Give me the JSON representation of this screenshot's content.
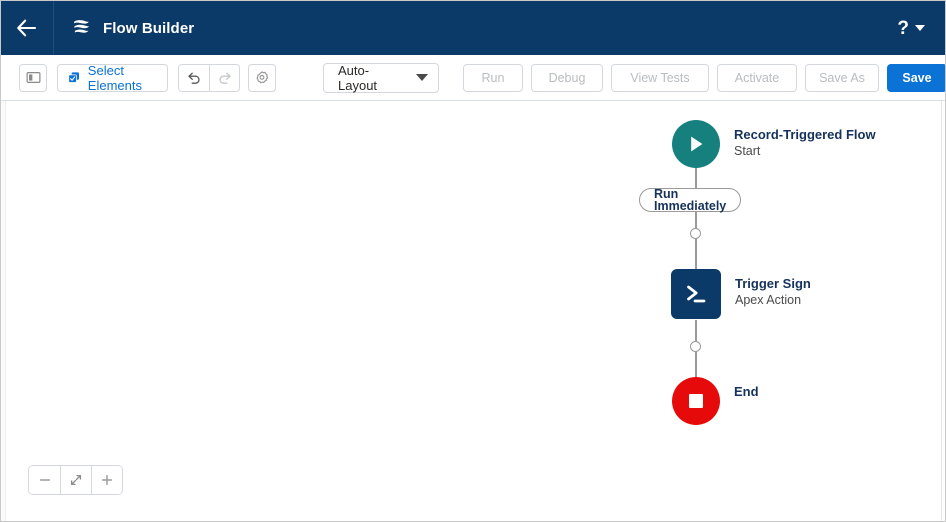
{
  "header": {
    "back_icon": "arrow-left-icon",
    "logo_icon": "flow-builder-logo-icon",
    "title": "Flow Builder",
    "help_label": "?",
    "help_icon": "help-question-icon",
    "caret_icon": "chevron-down-icon",
    "background": "#0b3a69"
  },
  "toolbar": {
    "toggle_panel_icon": "left-panel-toggle-icon",
    "select_elements": {
      "icon": "multi-select-checkbox-icon",
      "label": "Select Elements"
    },
    "undo_icon": "undo-arrow-icon",
    "redo_icon": "redo-arrow-icon",
    "settings_icon": "gear-icon",
    "layout_mode": {
      "value": "Auto-Layout",
      "caret_icon": "chevron-down-icon"
    },
    "run_label": "Run",
    "debug_label": "Debug",
    "view_tests_label": "View Tests",
    "activate_label": "Activate",
    "save_as_label": "Save As",
    "save_label": "Save",
    "primary_color": "#0b72d6"
  },
  "canvas": {
    "flow": {
      "start": {
        "icon": "play-triangle-icon",
        "title": "Record-Triggered Flow",
        "subtitle": "Start",
        "color": "#16807e"
      },
      "schedule_pill": {
        "label": "Run Immediately"
      },
      "add_element_top_icon": "add-element-circle-icon",
      "apex": {
        "icon": "apex-terminal-icon",
        "title": "Trigger Sign",
        "subtitle": "Apex Action",
        "color": "#0b3a69"
      },
      "add_element_bottom_icon": "add-element-circle-icon",
      "end": {
        "icon": "stop-square-icon",
        "title": "End",
        "color": "#e60a0a"
      },
      "connector_color": "#9a9a9a"
    },
    "zoom_controls": {
      "zoom_out_icon": "minus-icon",
      "fit_icon": "fit-to-view-icon",
      "zoom_in_icon": "plus-icon"
    }
  }
}
